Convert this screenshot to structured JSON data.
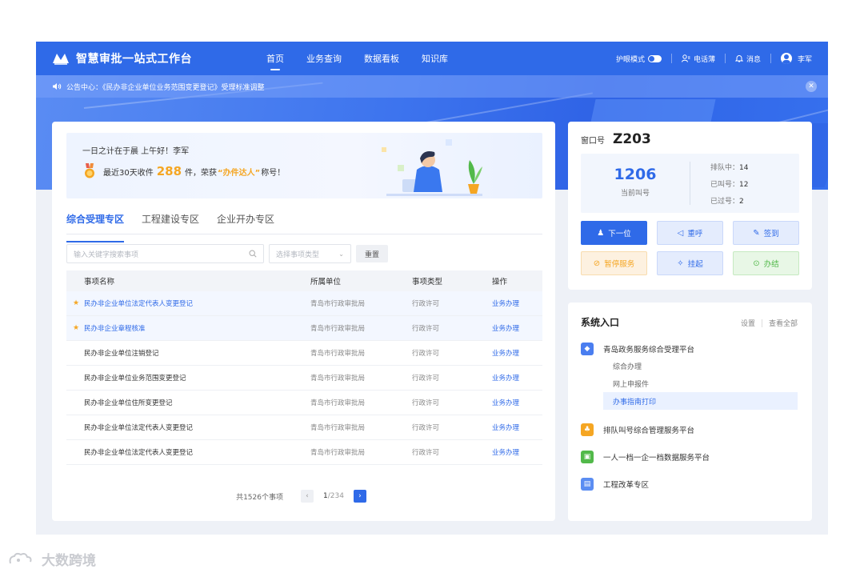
{
  "header": {
    "app_title": "智慧审批一站式工作台",
    "nav": [
      "首页",
      "业务查询",
      "数据看板",
      "知识库"
    ],
    "eye_mode": "护眼模式",
    "phonebook": "电话薄",
    "messages": "消息",
    "user": "李军"
  },
  "notice": {
    "text": "公告中心：《民办非企业单位业务范围变更登记》受理标准调整"
  },
  "greeting": {
    "line1": "一日之计在于晨  上午好！李军",
    "prefix": "最近30天收件",
    "count": "288",
    "mid": "件，荣获",
    "title": "“办件达人”",
    "suffix": "称号！"
  },
  "tabs": [
    "综合受理专区",
    "工程建设专区",
    "企业开办专区"
  ],
  "filters": {
    "search_placeholder": "输入关键字搜索事项",
    "type_placeholder": "选择事项类型",
    "reset": "重置"
  },
  "table": {
    "headers": [
      "事项名称",
      "所属单位",
      "事项类型",
      "操作"
    ],
    "rows": [
      {
        "name": "民办非企业单位法定代表人变更登记",
        "unit": "青岛市行政审批局",
        "type": "行政许可",
        "action": "业务办理",
        "starred": true
      },
      {
        "name": "民办非企业章程核准",
        "unit": "青岛市行政审批局",
        "type": "行政许可",
        "action": "业务办理",
        "starred": true
      },
      {
        "name": "民办非企业单位注销登记",
        "unit": "青岛市行政审批局",
        "type": "行政许可",
        "action": "业务办理",
        "starred": false
      },
      {
        "name": "民办非企业单位业务范围变更登记",
        "unit": "青岛市行政审批局",
        "type": "行政许可",
        "action": "业务办理",
        "starred": false
      },
      {
        "name": "民办非企业单位住所变更登记",
        "unit": "青岛市行政审批局",
        "type": "行政许可",
        "action": "业务办理",
        "starred": false
      },
      {
        "name": "民办非企业单位法定代表人变更登记",
        "unit": "青岛市行政审批局",
        "type": "行政许可",
        "action": "业务办理",
        "starred": false
      },
      {
        "name": "民办非企业单位法定代表人变更登记",
        "unit": "青岛市行政审批局",
        "type": "行政许可",
        "action": "业务办理",
        "starred": false
      }
    ]
  },
  "pagination": {
    "total": "共1526个事项",
    "current": "1",
    "pages": "/234"
  },
  "window": {
    "label": "窗口号",
    "number": "Z203",
    "current_call": "1206",
    "current_call_label": "当前叫号",
    "queue_label": "排队中：",
    "queue": "14",
    "called_label": "已叫号：",
    "called": "12",
    "passed_label": "已过号：",
    "passed": "2",
    "actions": [
      "下一位",
      "重呼",
      "签到",
      "暂停服务",
      "挂起",
      "办结"
    ]
  },
  "system": {
    "title": "系统入口",
    "settings": "设置",
    "view_all": "查看全部",
    "platforms": [
      {
        "name": "青岛政务服务综合受理平台",
        "color": "#4a7ef0",
        "icon": "ticket-icon"
      },
      {
        "name": "排队叫号综合管理服务平台",
        "color": "#f5a623",
        "icon": "queue-icon"
      },
      {
        "name": "一人一档一企一档数据服务平台",
        "color": "#52b94a",
        "icon": "archive-icon"
      },
      {
        "name": "工程改革专区",
        "color": "#5b8df2",
        "icon": "building-icon"
      }
    ],
    "sub_items": [
      "综合办理",
      "网上申报件",
      "办事指南打印"
    ]
  },
  "watermark": "大数跨境",
  "colors": {
    "primary": "#2f6ae8",
    "orange": "#f5a623",
    "green": "#52b94a"
  }
}
